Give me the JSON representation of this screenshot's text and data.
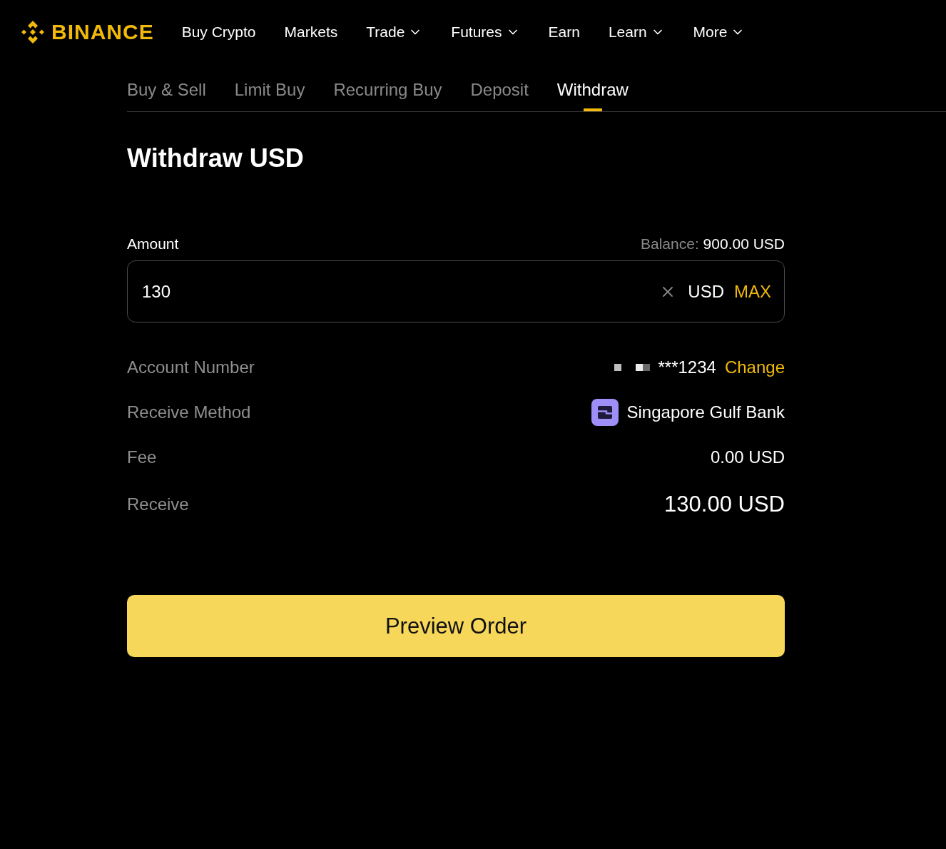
{
  "header": {
    "logo": "BINANCE",
    "nav": [
      {
        "label": "Buy Crypto",
        "dropdown": false
      },
      {
        "label": "Markets",
        "dropdown": false
      },
      {
        "label": "Trade",
        "dropdown": true
      },
      {
        "label": "Futures",
        "dropdown": true
      },
      {
        "label": "Earn",
        "dropdown": false
      },
      {
        "label": "Learn",
        "dropdown": true
      },
      {
        "label": "More",
        "dropdown": true
      }
    ]
  },
  "tabs": [
    {
      "label": "Buy & Sell",
      "selected": false
    },
    {
      "label": "Limit Buy",
      "selected": false
    },
    {
      "label": "Recurring Buy",
      "selected": false
    },
    {
      "label": "Deposit",
      "selected": false
    },
    {
      "label": "Withdraw",
      "selected": true
    }
  ],
  "title": "Withdraw USD",
  "amount": {
    "label": "Amount",
    "balance_label": "Balance:",
    "balance_value": "900.00 USD",
    "value": "130",
    "currency": "USD",
    "max": "MAX"
  },
  "details": [
    {
      "kind": "account",
      "label": "Account Number",
      "value": "***1234",
      "action": "Change"
    },
    {
      "kind": "bank",
      "label": "Receive Method",
      "value": "Singapore Gulf Bank"
    },
    {
      "kind": "plain",
      "label": "Fee",
      "value": "0.00 USD"
    },
    {
      "kind": "total",
      "label": "Receive",
      "value": "130.00 USD"
    }
  ],
  "button": "Preview Order"
}
